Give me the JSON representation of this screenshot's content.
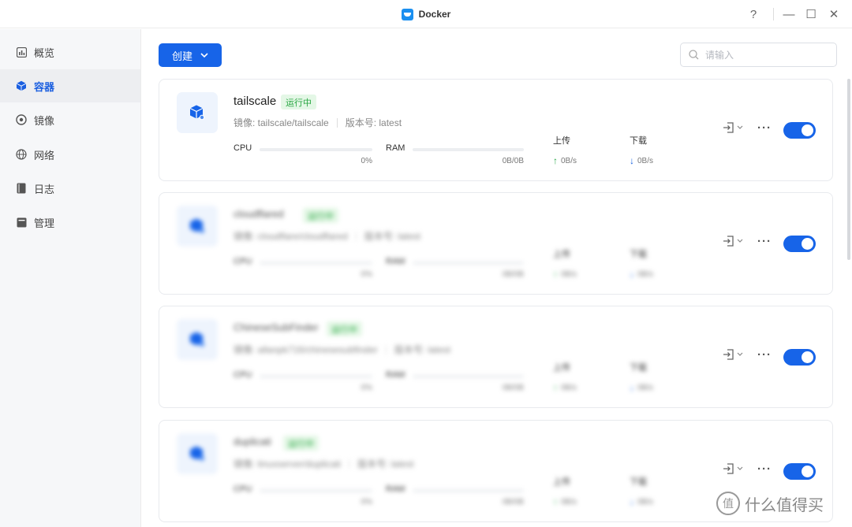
{
  "window": {
    "title": "Docker",
    "help": "?",
    "minimize": "—",
    "maximize": "☐",
    "close": "✕"
  },
  "sidebar": {
    "items": [
      {
        "label": "概览",
        "icon": "chart-icon"
      },
      {
        "label": "容器",
        "icon": "cube-icon",
        "active": true
      },
      {
        "label": "镜像",
        "icon": "disc-icon"
      },
      {
        "label": "网络",
        "icon": "globe-icon"
      },
      {
        "label": "日志",
        "icon": "book-icon"
      },
      {
        "label": "管理",
        "icon": "box-icon"
      }
    ]
  },
  "toolbar": {
    "create_label": "创建",
    "search_placeholder": "请输入"
  },
  "labels": {
    "cpu": "CPU",
    "ram": "RAM",
    "upload": "上传",
    "download": "下载"
  },
  "containers": [
    {
      "name": "tailscale",
      "status": "运行中",
      "image": "镜像: tailscale/tailscale",
      "version": "版本号: latest",
      "cpu_percent": "0%",
      "ram_usage": "0B/0B",
      "upload_rate": "0B/s",
      "download_rate": "0B/s",
      "enabled": true
    },
    {
      "name": "cloudflared",
      "status": "运行中",
      "image": "镜像: cloudflare/cloudflared",
      "version": "版本号: latest",
      "cpu_percent": "0%",
      "ram_usage": "0B/0B",
      "upload_rate": "0B/s",
      "download_rate": "0B/s",
      "enabled": true
    },
    {
      "name": "ChineseSubFinder",
      "status": "运行中",
      "image": "镜像: allanpk716/chinesesubfinder",
      "version": "版本号: latest",
      "cpu_percent": "0%",
      "ram_usage": "0B/0B",
      "upload_rate": "0B/s",
      "download_rate": "0B/s",
      "enabled": true
    },
    {
      "name": "duplicati",
      "status": "运行中",
      "image": "镜像: linuxserver/duplicati",
      "version": "版本号: latest",
      "cpu_percent": "0%",
      "ram_usage": "0B/0B",
      "upload_rate": "0B/s",
      "download_rate": "0B/s",
      "enabled": true
    }
  ],
  "watermark": {
    "icon": "值",
    "text": "什么值得买"
  },
  "colors": {
    "accent": "#1764e8",
    "running_badge_bg": "#e4f7e6",
    "running_badge_text": "#27a641",
    "upload_arrow": "#2aa84a",
    "download_arrow": "#1b64e0"
  }
}
